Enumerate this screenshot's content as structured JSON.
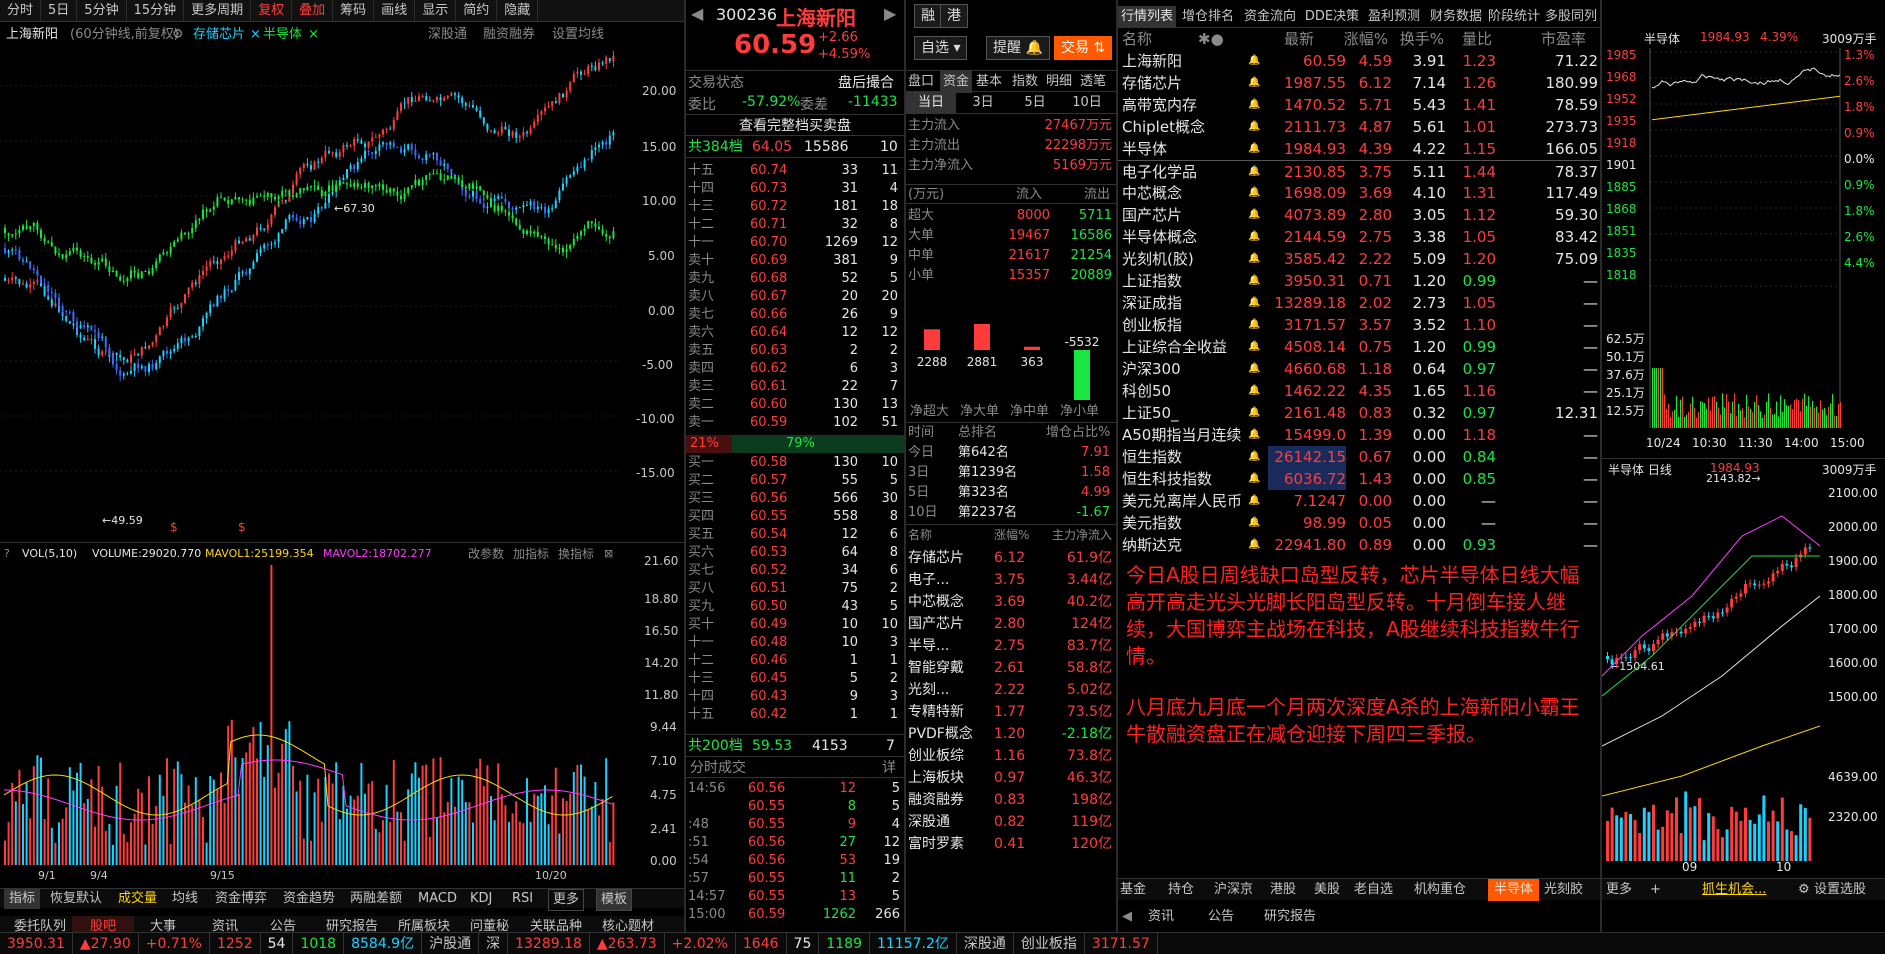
{
  "stock": {
    "code": "300236",
    "name": "上海新阳",
    "price": "60.59",
    "chg": "+2.66",
    "pct": "+4.59%"
  },
  "top_tabs": [
    "分时",
    "5日",
    "5分钟",
    "15分钟",
    "更多周期",
    "复权",
    "叠加",
    "筹码",
    "画线",
    "显示",
    "简约",
    "隐藏"
  ],
  "chart_header": {
    "name": "上海新阳",
    "period": "(60分钟线,前复权)",
    "overlay1": "存储芯片",
    "overlay2": "半导体",
    "links": [
      "深股通",
      "融资融券",
      "设置均线"
    ]
  },
  "price_axis": [
    "20.00",
    "15.00",
    "10.00",
    "5.00",
    "0.00",
    "-5.00",
    "-10.00",
    "-15.00"
  ],
  "chart_marks": {
    "high": "67.30",
    "low": "49.59"
  },
  "vol_header": {
    "vol": "VOL(5,10)",
    "volume": "VOLUME:29020.770",
    "mavol1": "MAVOL1:25199.354",
    "mavol2": "MAVOL2:18702.277",
    "links": [
      "改参数",
      "加指标",
      "换指标"
    ]
  },
  "vol_axis": [
    "21.60",
    "18.80",
    "16.50",
    "14.20",
    "11.80",
    "9.44",
    "7.10",
    "4.75",
    "2.41",
    "0.00"
  ],
  "date_axis": [
    "9/1",
    "9/4",
    "9/15",
    "10/20"
  ],
  "indicator_tabs": [
    "指标",
    "恢复默认",
    "成交量",
    "均线",
    "资金博弈",
    "资金趋势",
    "两融差额",
    "MACD",
    "KDJ",
    "RSI",
    "更多",
    "模板"
  ],
  "info_tabs": [
    "委托队列",
    "股吧",
    "大事",
    "资讯",
    "公告",
    "研究报告",
    "所属板块",
    "问董秘",
    "关联品种",
    "核心题材"
  ],
  "status": {
    "label": "交易状态",
    "value": "盘后撮合",
    "wb_label": "委比",
    "wb": "-57.92%",
    "wc_label": "委差",
    "wc": "-11433",
    "full": "查看完整档买卖盘"
  },
  "order_book_top": {
    "label": "共384档",
    "price": "64.05",
    "vol": "15586",
    "cnt": "10"
  },
  "asks": [
    [
      "十五",
      "60.74",
      "33",
      "11"
    ],
    [
      "十四",
      "60.73",
      "31",
      "4"
    ],
    [
      "十三",
      "60.72",
      "181",
      "18"
    ],
    [
      "十二",
      "60.71",
      "32",
      "8"
    ],
    [
      "十一",
      "60.70",
      "1269",
      "12"
    ],
    [
      "卖十",
      "60.69",
      "381",
      "9"
    ],
    [
      "卖九",
      "60.68",
      "52",
      "5"
    ],
    [
      "卖八",
      "60.67",
      "20",
      "20"
    ],
    [
      "卖七",
      "60.66",
      "26",
      "9"
    ],
    [
      "卖六",
      "60.64",
      "12",
      "12"
    ],
    [
      "卖五",
      "60.63",
      "2",
      "2"
    ],
    [
      "卖四",
      "60.62",
      "6",
      "3"
    ],
    [
      "卖三",
      "60.61",
      "22",
      "7"
    ],
    [
      "卖二",
      "60.60",
      "130",
      "13"
    ],
    [
      "卖一",
      "60.59",
      "102",
      "51"
    ]
  ],
  "bid_ratio": {
    "left": "21%",
    "right": "79%"
  },
  "bids": [
    [
      "买一",
      "60.58",
      "130",
      "10"
    ],
    [
      "买二",
      "60.57",
      "55",
      "5"
    ],
    [
      "买三",
      "60.56",
      "566",
      "30"
    ],
    [
      "买四",
      "60.55",
      "558",
      "8"
    ],
    [
      "买五",
      "60.54",
      "12",
      "6"
    ],
    [
      "买六",
      "60.53",
      "64",
      "8"
    ],
    [
      "买七",
      "60.52",
      "34",
      "6"
    ],
    [
      "买八",
      "60.51",
      "75",
      "2"
    ],
    [
      "买九",
      "60.50",
      "43",
      "5"
    ],
    [
      "买十",
      "60.49",
      "10",
      "10"
    ],
    [
      "十一",
      "60.48",
      "10",
      "3"
    ],
    [
      "十二",
      "60.46",
      "1",
      "1"
    ],
    [
      "十三",
      "60.45",
      "5",
      "2"
    ],
    [
      "十四",
      "60.43",
      "9",
      "3"
    ],
    [
      "十五",
      "60.42",
      "1",
      "1"
    ]
  ],
  "order_book_bottom": {
    "label": "共200档",
    "price": "59.53",
    "vol": "4153",
    "cnt": "7"
  },
  "ticks_header": {
    "title": "分时成交",
    "detail": "详"
  },
  "ticks": [
    [
      "14:56",
      "60.56",
      "12",
      "5"
    ],
    [
      "",
      "60.55",
      "8",
      "5"
    ],
    [
      ":48",
      "60.55",
      "9",
      "4"
    ],
    [
      ":51",
      "60.56",
      "27",
      "12"
    ],
    [
      ":54",
      "60.56",
      "53",
      "19"
    ],
    [
      ":57",
      "60.55",
      "11",
      "2"
    ],
    [
      "14:57",
      "60.55",
      "13",
      "5"
    ],
    [
      "15:00",
      "60.59",
      "1262",
      "266"
    ]
  ],
  "mid_buttons": {
    "rong": "融",
    "gang": "港",
    "zixuan": "自选",
    "tixing": "提醒",
    "trade": "交易"
  },
  "fund_tabs": [
    "盘口",
    "资金",
    "基本",
    "指数",
    "明细",
    "透笔"
  ],
  "fund_days": [
    "当日",
    "3日",
    "5日",
    "10日"
  ],
  "flows": [
    [
      "主力流入",
      "27467万元"
    ],
    [
      "主力流出",
      "22298万元"
    ],
    [
      "主力净流入",
      "5169万元"
    ]
  ],
  "flow_table": {
    "unit": "(万元)",
    "in": "流入",
    "out": "流出",
    "rows": [
      [
        "超大",
        "8000",
        "5711"
      ],
      [
        "大单",
        "19467",
        "16586"
      ],
      [
        "中单",
        "21617",
        "21254"
      ],
      [
        "小单",
        "15357",
        "20889"
      ]
    ]
  },
  "net_bars": {
    "values": [
      2288,
      2881,
      363,
      -5532
    ],
    "labels": [
      "净超大",
      "净大单",
      "净中单",
      "净小单"
    ]
  },
  "rank": {
    "head": [
      "时间",
      "总排名",
      "增仓占比%"
    ],
    "rows": [
      [
        "今日",
        "第642名",
        "7.91"
      ],
      [
        "3日",
        "第1239名",
        "1.58"
      ],
      [
        "5日",
        "第323名",
        "4.99"
      ],
      [
        "10日",
        "第2237名",
        "-1.67"
      ]
    ]
  },
  "sectors": {
    "head": [
      "名称",
      "涨幅%",
      "主力净流入"
    ],
    "rows": [
      [
        "存储芯片",
        "6.12",
        "61.9亿"
      ],
      [
        "电子...",
        "3.75",
        "3.44亿"
      ],
      [
        "中芯概念",
        "3.69",
        "40.2亿"
      ],
      [
        "国产芯片",
        "2.80",
        "124亿"
      ],
      [
        "半导...",
        "2.75",
        "83.7亿"
      ],
      [
        "智能穿戴",
        "2.61",
        "58.8亿"
      ],
      [
        "光刻...",
        "2.22",
        "5.02亿"
      ],
      [
        "专精特新",
        "1.77",
        "73.5亿"
      ],
      [
        "PVDF概念",
        "1.20",
        "-2.18亿"
      ],
      [
        "创业板综",
        "1.16",
        "73.8亿"
      ],
      [
        "上海板块",
        "0.97",
        "46.3亿"
      ],
      [
        "融资融券",
        "0.83",
        "198亿"
      ],
      [
        "深股通",
        "0.82",
        "119亿"
      ],
      [
        "富时罗素",
        "0.41",
        "120亿"
      ]
    ]
  },
  "mkt_tabs": [
    "行情列表",
    "增仓排名",
    "资金流向",
    "DDE决策",
    "盈利预测",
    "财务数据",
    "阶段统计",
    "多股同列"
  ],
  "mkt_head": [
    "名称",
    "最新",
    "涨幅%",
    "换手%",
    "量比",
    "市盈率"
  ],
  "mkt_rows": [
    [
      "上海新阳",
      "60.59",
      "4.59",
      "3.91",
      "1.23",
      "71.22"
    ],
    [
      "存储芯片",
      "1987.55",
      "6.12",
      "7.14",
      "1.26",
      "180.99"
    ],
    [
      "高带宽内存",
      "1470.52",
      "5.71",
      "5.43",
      "1.41",
      "78.59"
    ],
    [
      "Chiplet概念",
      "2111.73",
      "4.87",
      "5.61",
      "1.01",
      "273.73"
    ],
    [
      "半导体",
      "1984.93",
      "4.39",
      "4.22",
      "1.15",
      "166.05"
    ],
    [
      "电子化学品",
      "2130.85",
      "3.75",
      "5.11",
      "1.44",
      "78.37"
    ],
    [
      "中芯概念",
      "1698.09",
      "3.69",
      "4.10",
      "1.31",
      "117.49"
    ],
    [
      "国产芯片",
      "4073.89",
      "2.80",
      "3.05",
      "1.12",
      "59.30"
    ],
    [
      "半导体概念",
      "2144.59",
      "2.75",
      "3.38",
      "1.05",
      "83.42"
    ],
    [
      "光刻机(胶)",
      "3585.42",
      "2.22",
      "5.09",
      "1.20",
      "75.09"
    ],
    [
      "上证指数",
      "3950.31",
      "0.71",
      "1.20",
      "0.99",
      "—"
    ],
    [
      "深证成指",
      "13289.18",
      "2.02",
      "2.73",
      "1.05",
      "—"
    ],
    [
      "创业板指",
      "3171.57",
      "3.57",
      "3.52",
      "1.10",
      "—"
    ],
    [
      "上证综合全收益",
      "4508.14",
      "0.75",
      "1.20",
      "0.99",
      "—"
    ],
    [
      "沪深300",
      "4660.68",
      "1.18",
      "0.64",
      "0.97",
      "—"
    ],
    [
      "科创50",
      "1462.22",
      "4.35",
      "1.65",
      "1.16",
      "—"
    ],
    [
      "上证50_",
      "2161.48",
      "0.83",
      "0.32",
      "0.97",
      "12.31"
    ],
    [
      "A50期指当月连续",
      "15499.0",
      "1.39",
      "0.00",
      "1.18",
      "—"
    ],
    [
      "恒生指数",
      "26142.15",
      "0.67",
      "0.00",
      "0.84",
      "—"
    ],
    [
      "恒生科技指数",
      "6036.72",
      "1.43",
      "0.00",
      "0.85",
      "—"
    ],
    [
      "美元兑离岸人民币",
      "7.1247",
      "0.00",
      "0.00",
      "—",
      "—"
    ],
    [
      "美元指数",
      "98.99",
      "0.05",
      "0.00",
      "—",
      "—"
    ],
    [
      "纳斯达克",
      "22941.80",
      "0.89",
      "0.00",
      "0.93",
      "—"
    ]
  ],
  "comment1": "今日A股日周线缺口岛型反转，芯片半导体日线大幅高开高走光头光脚长阳岛型反转。十月倒车接人继续，大国博弈主战场在科技，A股继续科技指数牛行情。",
  "comment2": "八月底九月底一个月两次深度A杀的上海新阳小霸王牛散融资盘正在减仓迎接下周四三季报。",
  "bottom_tabs": [
    "基金",
    "持仓",
    "沪深京",
    "港股",
    "美股",
    "老自选",
    "机构重仓",
    "半导体",
    "光刻胶",
    "更多",
    "+",
    "抓生机会...",
    "设置选股"
  ],
  "bottom_tabs2": [
    "资讯",
    "公告",
    "研究报告"
  ],
  "mini1": {
    "title": "半导体",
    "price": "1984.93",
    "pct": "4.39%",
    "vol": "3009万手",
    "left": [
      "1985",
      "1968",
      "1952",
      "1935",
      "1918",
      "1901",
      "1885",
      "1868",
      "1851",
      "1835",
      "1818"
    ],
    "right": [
      "1.3%",
      "2.6%",
      "1.8%",
      "0.9%",
      "0.0%",
      "0.9%",
      "1.8%",
      "2.6%",
      "4.4%"
    ],
    "vol_axis": [
      "62.5万",
      "50.1万",
      "37.6万",
      "25.1万",
      "12.5万"
    ],
    "times": [
      "10/24",
      "10:30",
      "11:30",
      "14:00",
      "15:00"
    ]
  },
  "mini2": {
    "title": "半导体 日线",
    "price": "1984.93",
    "vol": "3009万手",
    "high": "2143.82",
    "low": "1504.61",
    "axis": [
      "2100.00",
      "2000.00",
      "1900.00",
      "1800.00",
      "1700.00",
      "1600.00",
      "1500.00"
    ],
    "vol_axis": [
      "4639.00",
      "2320.00"
    ],
    "months": [
      "09",
      "10"
    ]
  },
  "footer": [
    "3950.31",
    "▲27.90",
    "+0.71%",
    "1252",
    "54",
    "1018",
    "8584.9亿",
    "沪股通",
    "深",
    "13289.18",
    "▲263.73",
    "+2.02%",
    "1646",
    "75",
    "1189",
    "11157.2亿",
    "深股通",
    "创业板指",
    "3171.57"
  ]
}
